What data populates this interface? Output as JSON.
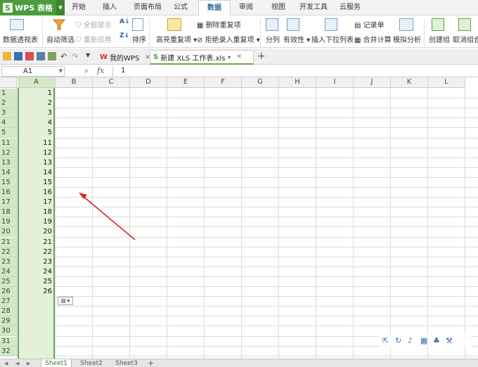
{
  "app": {
    "title": "WPS 表格"
  },
  "menu": {
    "tabs": [
      "开始",
      "插入",
      "页面布局",
      "公式",
      "数据",
      "审阅",
      "视图",
      "开发工具",
      "云服务"
    ],
    "active": "数据"
  },
  "ribbon": {
    "pivot": "数据透视表",
    "autofilter": "自动筛选",
    "show_all": "全部显示",
    "reapply": "重新应用",
    "sort": "排序",
    "highlight_dup": "高亮重复项",
    "remove_dup": "删除重复项",
    "reject_dup": "拒绝录入重复项",
    "split": "分列",
    "validity": "有效性",
    "insert_dropdown": "插入下拉列表",
    "record_form": "记录单",
    "consolidate": "合并计算",
    "what_if": "模拟分析",
    "group": "创建组",
    "ungroup": "取消组合"
  },
  "doc_tabs": [
    {
      "label": "我的WPS",
      "active": false
    },
    {
      "label": "新建 XLS 工作表.xls *",
      "active": true
    }
  ],
  "formula_bar": {
    "name_box": "A1",
    "fx": "fx",
    "value": "1"
  },
  "columns": [
    "A",
    "B",
    "C",
    "D",
    "E",
    "F",
    "G",
    "H",
    "I",
    "J",
    "K",
    "L"
  ],
  "rows": [
    {
      "header": "1",
      "value": "1"
    },
    {
      "header": "2",
      "value": "2"
    },
    {
      "header": "3",
      "value": "3"
    },
    {
      "header": "4",
      "value": "4"
    },
    {
      "header": "5",
      "value": "5"
    },
    {
      "header": "11",
      "value": "11"
    },
    {
      "header": "12",
      "value": "12"
    },
    {
      "header": "13",
      "value": "13"
    },
    {
      "header": "14",
      "value": "14"
    },
    {
      "header": "15",
      "value": "15"
    },
    {
      "header": "16",
      "value": "16"
    },
    {
      "header": "17",
      "value": "17"
    },
    {
      "header": "18",
      "value": "18"
    },
    {
      "header": "19",
      "value": "19"
    },
    {
      "header": "20",
      "value": "20"
    },
    {
      "header": "21",
      "value": "21"
    },
    {
      "header": "22",
      "value": "22"
    },
    {
      "header": "23",
      "value": "23"
    },
    {
      "header": "24",
      "value": "24"
    },
    {
      "header": "25",
      "value": "25"
    },
    {
      "header": "26",
      "value": "26"
    },
    {
      "header": "27",
      "value": ""
    },
    {
      "header": "28",
      "value": ""
    },
    {
      "header": "29",
      "value": ""
    },
    {
      "header": "30",
      "value": ""
    },
    {
      "header": "31",
      "value": ""
    },
    {
      "header": "32",
      "value": ""
    }
  ],
  "sheets": [
    "Sheet1",
    "Sheet2",
    "Sheet3"
  ],
  "active_sheet": "Sheet1",
  "colors": {
    "accent": "#4b9c3a",
    "selection": "#e3f1d9",
    "arrow": "#e02020"
  }
}
